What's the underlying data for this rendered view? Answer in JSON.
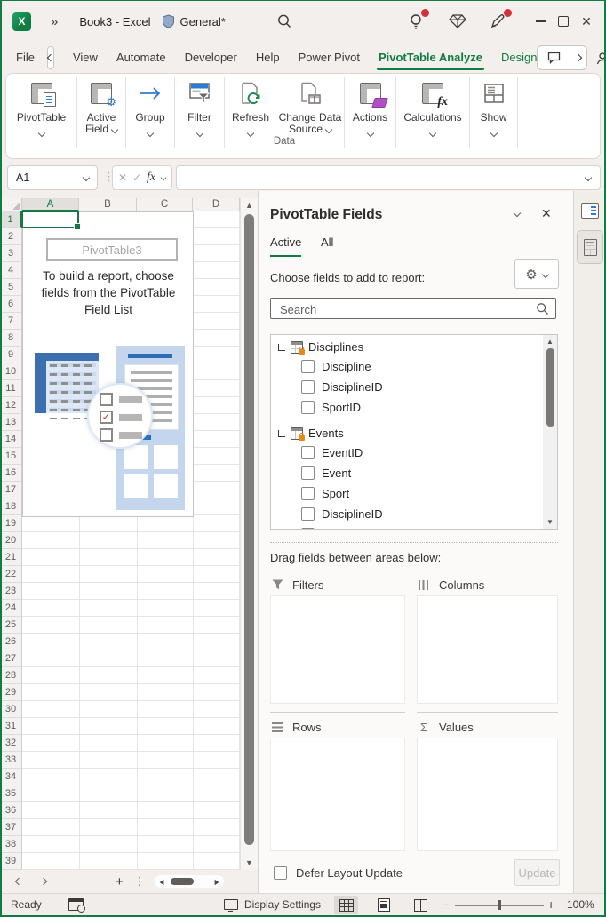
{
  "window": {
    "overflow_chevron": "»",
    "title": "Book3  -  Excel",
    "sensitivity_label": "General*"
  },
  "ribbon_tabs": {
    "file": "File",
    "view": "View",
    "automate": "Automate",
    "developer": "Developer",
    "help": "Help",
    "power_pivot": "Power Pivot",
    "pivottable_analyze": "PivotTable Analyze",
    "design": "Design"
  },
  "ribbon": {
    "buttons": {
      "pivottable": "PivotTable",
      "active_field_line1": "Active",
      "active_field_line2": "Field",
      "group": "Group",
      "filter": "Filter",
      "refresh": "Refresh",
      "change_data_line1": "Change Data",
      "change_data_line2": "Source",
      "actions": "Actions",
      "calculations": "Calculations",
      "show": "Show"
    },
    "group_label": "Data",
    "fx_glyph": "fx"
  },
  "formula_bar": {
    "name_box_value": "A1",
    "cancel_glyph": "✕",
    "enter_glyph": "✓",
    "fx_glyph": "fx"
  },
  "grid": {
    "columns": [
      "A",
      "B",
      "C",
      "D"
    ],
    "row_count": 39,
    "selected_cell": "A1"
  },
  "pivot_placeholder": {
    "name": "PivotTable3",
    "message": "To build a report, choose fields from the PivotTable Field List"
  },
  "fields_pane": {
    "title": "PivotTable Fields",
    "tabs": {
      "active": "Active",
      "all": "All"
    },
    "choose_label": "Choose fields to add to report:",
    "gear_glyph": "⚙",
    "search_placeholder": "Search",
    "field_tree": [
      {
        "table": "Disciplines",
        "fields": [
          "Discipline",
          "DisciplineID",
          "SportID"
        ]
      },
      {
        "table": "Events",
        "fields": [
          "EventID",
          "Event",
          "Sport",
          "DisciplineID",
          "Discipline"
        ]
      }
    ],
    "drag_label": "Drag fields between areas below:",
    "areas": {
      "filters": "Filters",
      "columns": "Columns",
      "rows": "Rows",
      "values": "Values",
      "sigma_glyph": "Σ"
    },
    "defer_label": "Defer Layout Update",
    "update_button": "Update"
  },
  "status_bar": {
    "ready": "Ready",
    "display_settings": "Display Settings",
    "zoom_level": "100%"
  }
}
